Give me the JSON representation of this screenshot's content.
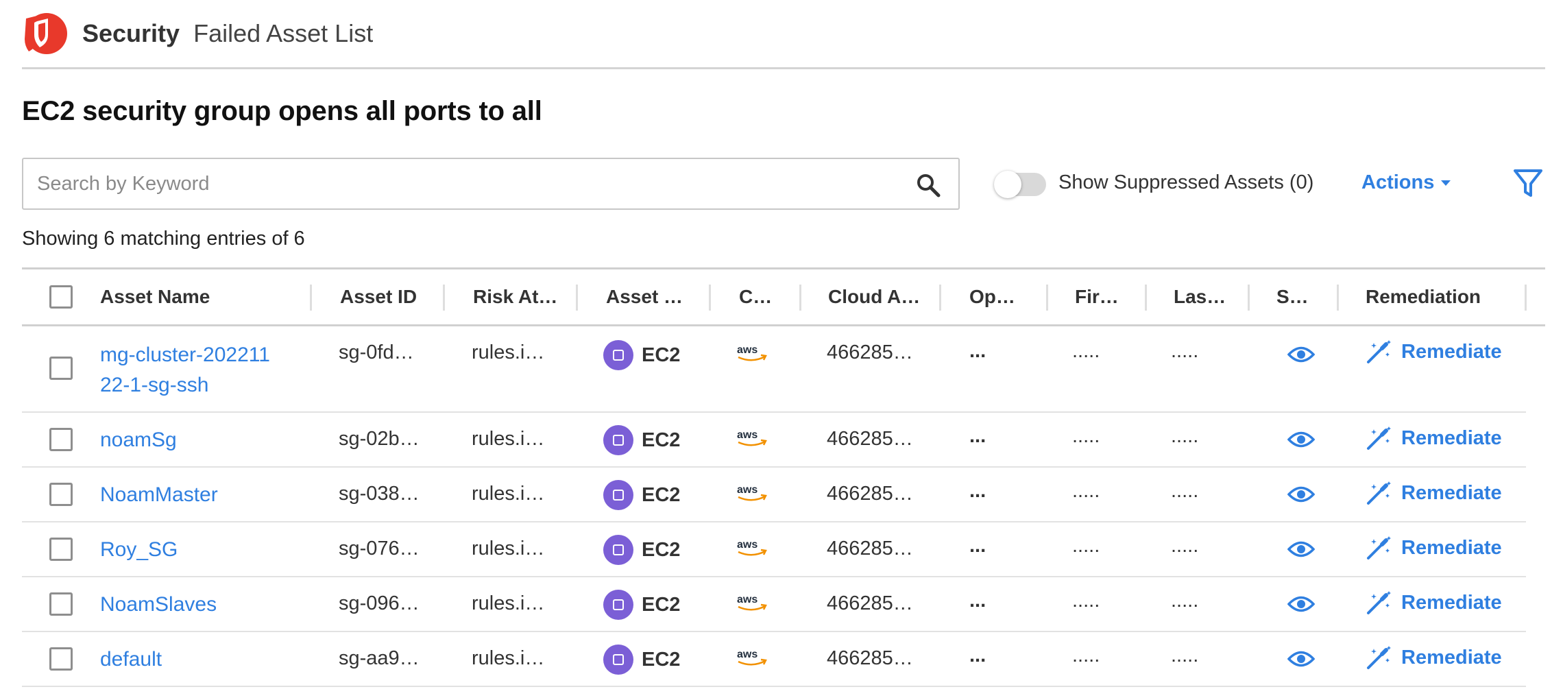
{
  "header": {
    "brand": "Security",
    "breadcrumb": "Failed Asset List"
  },
  "page_title": "EC2 security group opens all ports to all",
  "search": {
    "placeholder": "Search by Keyword",
    "value": ""
  },
  "toggle": {
    "label": "Show Suppressed Assets (0)",
    "on": false
  },
  "actions_label": "Actions",
  "showing_text": "Showing 6 matching entries of 6",
  "columns": [
    "Asset Name",
    "Asset ID",
    "Risk At…",
    "Asset …",
    "C…",
    "Cloud A…",
    "Op…",
    "Fir…",
    "Las…",
    "S…",
    "Remediation"
  ],
  "rows": [
    {
      "name": "mg-cluster-20221122-1-sg-ssh",
      "asset_id": "sg-0fd…",
      "risk": "rules.i…",
      "type": "EC2",
      "cloud": "aws",
      "account": "466285…",
      "op": "...",
      "first": ".....",
      "last": ".....",
      "remediate": "Remediate"
    },
    {
      "name": "noamSg",
      "asset_id": "sg-02b…",
      "risk": "rules.i…",
      "type": "EC2",
      "cloud": "aws",
      "account": "466285…",
      "op": "...",
      "first": ".....",
      "last": ".....",
      "remediate": "Remediate"
    },
    {
      "name": "NoamMaster",
      "asset_id": "sg-038…",
      "risk": "rules.i…",
      "type": "EC2",
      "cloud": "aws",
      "account": "466285…",
      "op": "...",
      "first": ".....",
      "last": ".....",
      "remediate": "Remediate"
    },
    {
      "name": "Roy_SG",
      "asset_id": "sg-076…",
      "risk": "rules.i…",
      "type": "EC2",
      "cloud": "aws",
      "account": "466285…",
      "op": "...",
      "first": ".....",
      "last": ".....",
      "remediate": "Remediate"
    },
    {
      "name": "NoamSlaves",
      "asset_id": "sg-096…",
      "risk": "rules.i…",
      "type": "EC2",
      "cloud": "aws",
      "account": "466285…",
      "op": "...",
      "first": ".....",
      "last": ".....",
      "remediate": "Remediate"
    },
    {
      "name": "default",
      "asset_id": "sg-aa9…",
      "risk": "rules.i…",
      "type": "EC2",
      "cloud": "aws",
      "account": "466285…",
      "op": "...",
      "first": ".....",
      "last": ".....",
      "remediate": "Remediate"
    }
  ],
  "icons": {
    "logo": "shield-logo-icon",
    "search": "search-icon",
    "filter": "filter-icon",
    "asset_type": "ec2-icon",
    "cloud": "aws-logo-icon",
    "view": "eye-icon",
    "remediate": "magic-wand-icon"
  },
  "colors": {
    "brand_red": "#e8392b",
    "link_blue": "#2f7fe0",
    "ec2_purple": "#7b5fd6",
    "aws_orange": "#f29100"
  }
}
